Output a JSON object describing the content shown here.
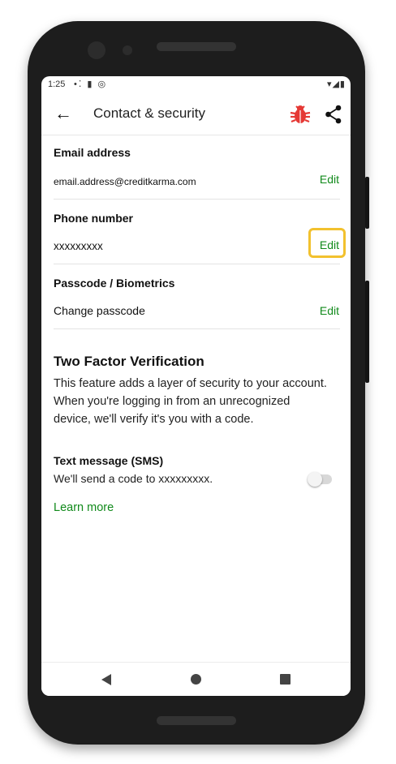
{
  "status_bar": {
    "time": "1:25",
    "notification_icons": "•⁚ ▮ ◎",
    "system_icons": "▾◢▮"
  },
  "app_bar": {
    "title": "Contact & security",
    "back_icon": "arrow-left",
    "bug_icon": "bug",
    "share_icon": "share"
  },
  "sections": [
    {
      "label": "Email address",
      "value": "email.address@creditkarma.com",
      "action": "Edit"
    },
    {
      "label": "Phone number",
      "value": "xxxxxxxxx",
      "action": "Edit"
    },
    {
      "label": "Passcode / Biometrics",
      "value": "Change passcode",
      "action": "Edit"
    }
  ],
  "two_factor": {
    "title": "Two Factor Verification",
    "description": "This feature adds a layer of security to your account. When you're logging in from an unrecognized device, we'll verify it's you with a code.",
    "sms_label": "Text message (SMS)",
    "sms_description": "We'll send a code to xxxxxxxxx.",
    "sms_enabled": false,
    "learn_more": "Learn more"
  },
  "colors": {
    "accent_green": "#118a1b",
    "highlight_yellow": "#f2c12e",
    "bug_red": "#e53935"
  }
}
